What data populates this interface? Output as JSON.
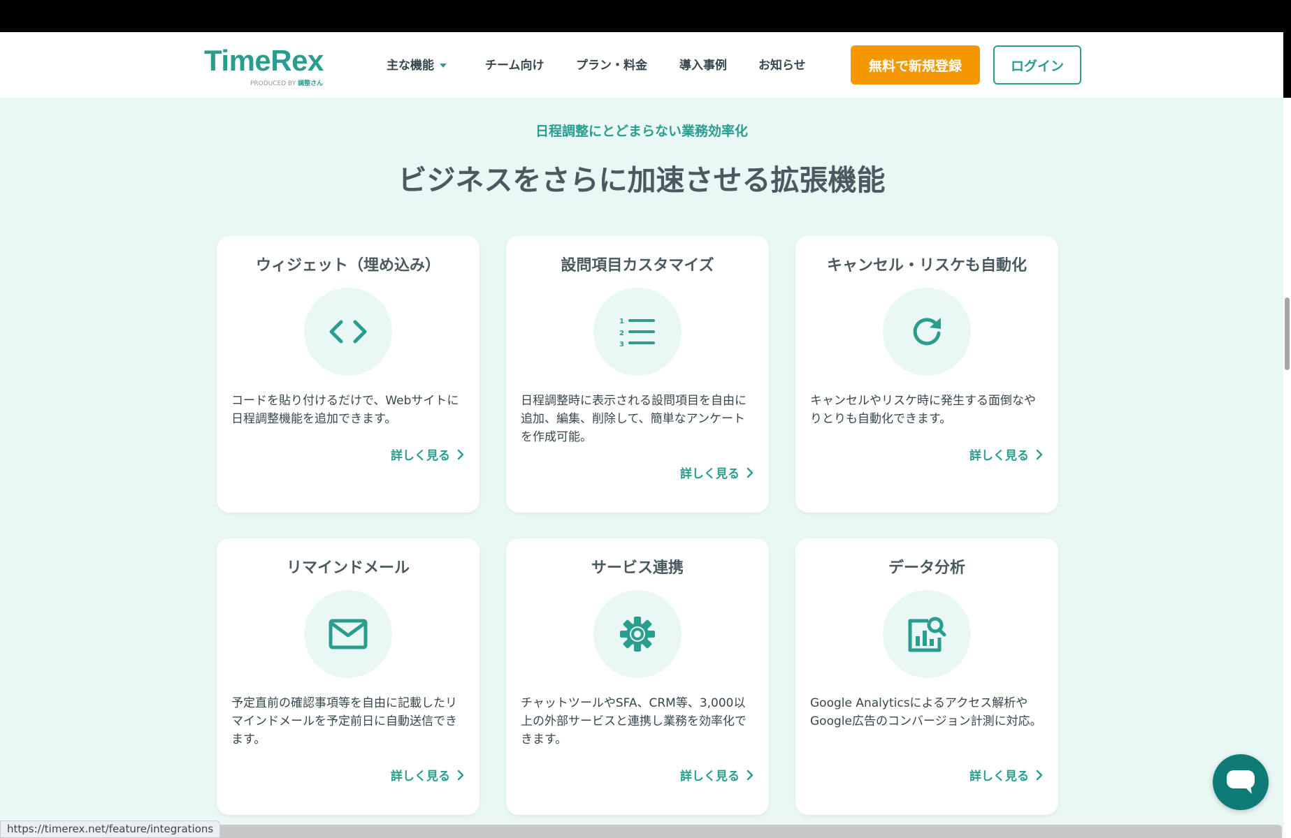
{
  "header": {
    "logo_text": "TimeRex",
    "logo_sub_prefix": "PRODUCED BY",
    "logo_sub_brand": "調整さん",
    "nav": [
      {
        "label": "主な機能",
        "dropdown": true
      },
      {
        "label": "チーム向け"
      },
      {
        "label": "プラン・料金"
      },
      {
        "label": "導入事例"
      },
      {
        "label": "お知らせ"
      }
    ],
    "signup_label": "無料で新規登録",
    "login_label": "ログイン"
  },
  "section": {
    "eyebrow": "日程調整にとどまらない業務効率化",
    "headline": "ビジネスをさらに加速させる拡張機能"
  },
  "cards": [
    {
      "title": "ウィジェット（埋め込み）",
      "icon": "code-icon",
      "desc": "コードを貼り付けるだけで、Webサイトに日程調整機能を追加できます。",
      "link": "詳しく見る"
    },
    {
      "title": "設問項目カスタマイズ",
      "icon": "numbered-list-icon",
      "desc": "日程調整時に表示される設問項目を自由に追加、編集、削除して、簡単なアンケートを作成可能。",
      "link": "詳しく見る"
    },
    {
      "title": "キャンセル・リスケも自動化",
      "icon": "refresh-icon",
      "desc": "キャンセルやリスケ時に発生する面倒なやりとりも自動化できます。",
      "link": "詳しく見る"
    },
    {
      "title": "リマインドメール",
      "icon": "mail-icon",
      "desc": "予定直前の確認事項等を自由に記載したリマインドメールを予定前日に自動送信できます。",
      "link": "詳しく見る"
    },
    {
      "title": "サービス連携",
      "icon": "gear-icon",
      "desc": "チャットツールやSFA、CRM等、3,000以上の外部サービスと連携し業務を効率化できます。",
      "link": "詳しく見る"
    },
    {
      "title": "データ分析",
      "icon": "analytics-icon",
      "desc": "Google Analyticsによるアクセス解析やGoogle広告のコンバージョン計測に対応。",
      "link": "詳しく見る"
    }
  ],
  "status_bar": {
    "url": "https://timerex.net/feature/integrations"
  },
  "colors": {
    "brand": "#2a9d8f",
    "accent": "#f39800",
    "section_bg": "#e9f7f5",
    "chat": "#0f7b76"
  }
}
